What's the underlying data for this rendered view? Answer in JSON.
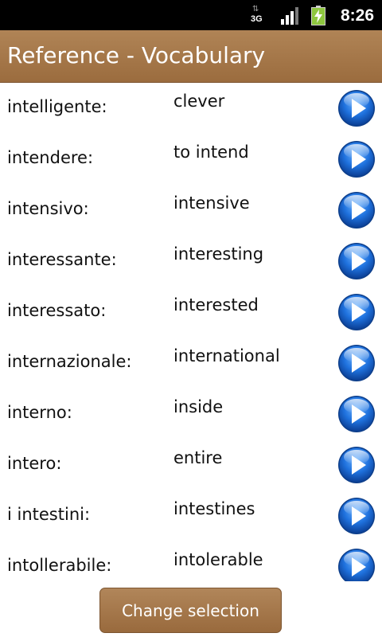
{
  "status_bar": {
    "network_label": "3G",
    "network_icon": "3g-data-icon",
    "signal_icon": "signal-strength-icon",
    "battery_icon": "battery-charging-icon",
    "time": "8:26"
  },
  "header": {
    "title": "Reference - Vocabulary",
    "color": "#a87a4b"
  },
  "vocabulary": [
    {
      "term": "intelligente:",
      "translation": "clever"
    },
    {
      "term": "intendere:",
      "translation": "to intend"
    },
    {
      "term": "intensivo:",
      "translation": "intensive"
    },
    {
      "term": "interessante:",
      "translation": "interesting"
    },
    {
      "term": "interessato:",
      "translation": "interested"
    },
    {
      "term": "internazionale:",
      "translation": "international"
    },
    {
      "term": "interno:",
      "translation": "inside"
    },
    {
      "term": "intero:",
      "translation": "entire"
    },
    {
      "term": "i intestini:",
      "translation": "intestines"
    },
    {
      "term": "intollerabile:",
      "translation": "intolerable"
    }
  ],
  "row_play_icon": "play-audio-icon",
  "footer": {
    "change_selection_label": "Change selection"
  },
  "colors": {
    "accent": "#a87a4b",
    "play_button": "#1e6fd9"
  }
}
